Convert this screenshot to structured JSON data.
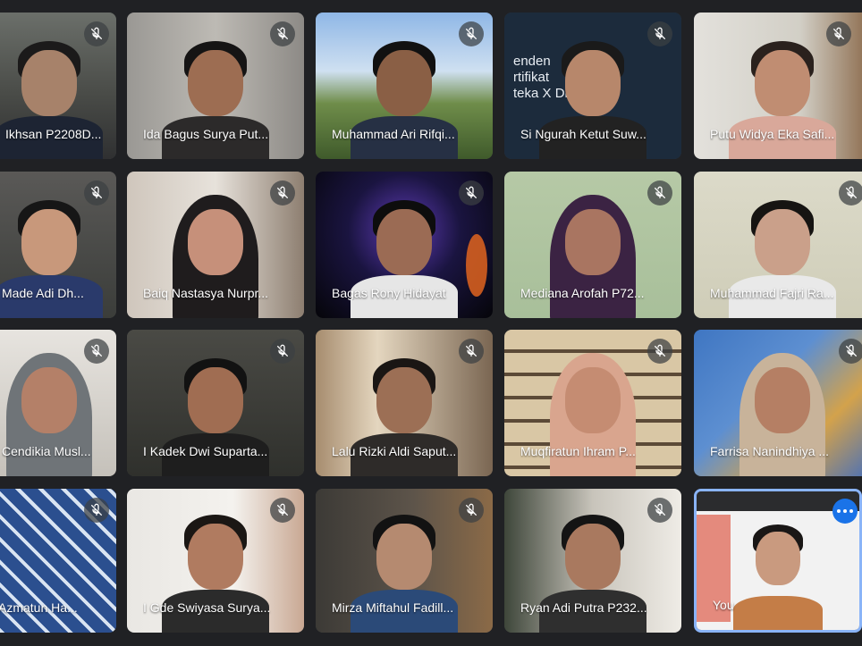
{
  "app": {
    "accent_color": "#1a73e8",
    "background_color": "#202124"
  },
  "participants": [
    {
      "name": "Ikhsan P2208D...",
      "muted": true
    },
    {
      "name": "Ida Bagus Surya Put...",
      "muted": true
    },
    {
      "name": "Muhammad Ari Rifqi...",
      "muted": true
    },
    {
      "name": "Si Ngurah Ketut Suw...",
      "muted": true,
      "background_text": "enden\nrtifikat\nteka X Dicoding"
    },
    {
      "name": "Putu Widya Eka Safi...",
      "muted": true
    },
    {
      "name": "Made Adi Dh...",
      "muted": true
    },
    {
      "name": "Baiq Nastasya Nurpr...",
      "muted": true
    },
    {
      "name": "Bagas Rony Hidayat",
      "muted": true
    },
    {
      "name": "Mediana Arofah P72...",
      "muted": true
    },
    {
      "name": "Muhammad Fajri Ra...",
      "muted": true
    },
    {
      "name": "Cendikia Musl...",
      "muted": true
    },
    {
      "name": "I Kadek Dwi Suparta...",
      "muted": true
    },
    {
      "name": "Lalu Rizki Aldi Saput...",
      "muted": true
    },
    {
      "name": "Muqfiratun Ihram P...",
      "muted": true
    },
    {
      "name": "Farrisa Nanindhiya ...",
      "muted": true
    },
    {
      "name": "Azmatun Ha...",
      "muted": true
    },
    {
      "name": "I Gde Swiyasa Surya...",
      "muted": true
    },
    {
      "name": "Mirza Miftahul Fadill...",
      "muted": true
    },
    {
      "name": "Ryan Adi Putra P232...",
      "muted": true
    },
    {
      "name": "You",
      "muted": false,
      "is_self": true
    }
  ],
  "icons": {
    "mute": "mic-off-icon",
    "more": "more-options-icon"
  }
}
